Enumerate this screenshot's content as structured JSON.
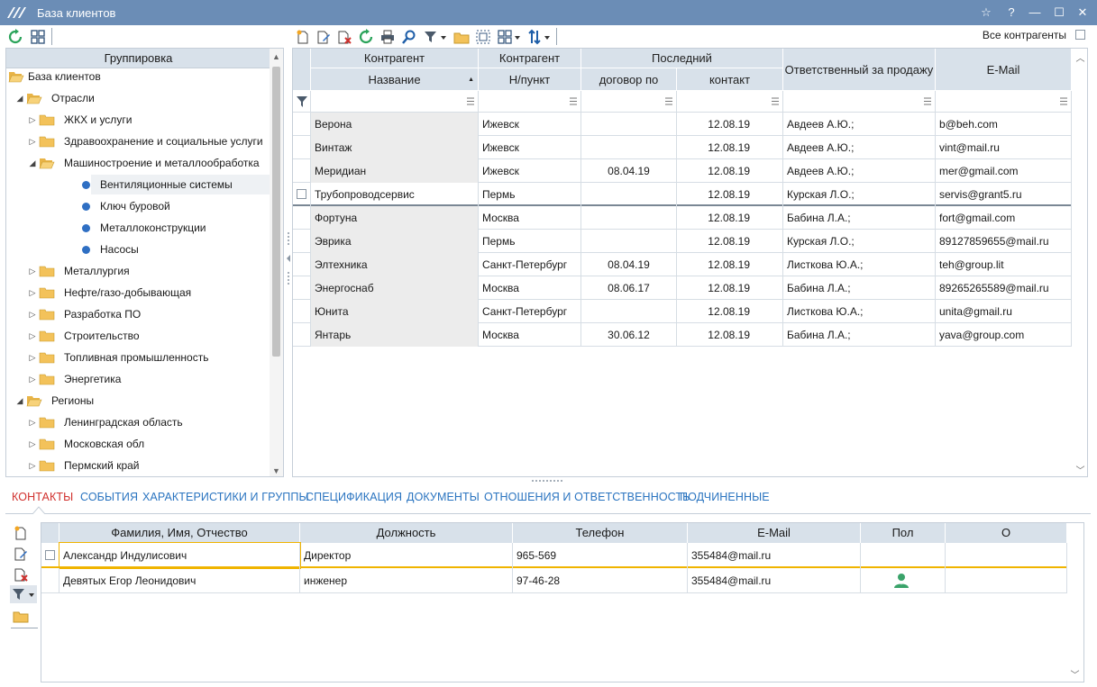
{
  "window": {
    "title": "База клиентов",
    "buttons": [
      "☆",
      "?",
      "—",
      "☐",
      "✕"
    ]
  },
  "toolbar": {
    "all_counterparties_label": "Все контрагенты"
  },
  "tree": {
    "header": "Группировка",
    "items": [
      {
        "label": "База клиентов",
        "kind": "root"
      },
      {
        "label": "Отрасли",
        "kind": "group-open"
      },
      {
        "label": "ЖКХ и услуги",
        "kind": "folder"
      },
      {
        "label": "Здравоохранение и социальные услуги",
        "kind": "folder"
      },
      {
        "label": "Машиностроение и металлообработка",
        "kind": "folder-open"
      },
      {
        "label": "Вентиляционные системы",
        "kind": "leaf",
        "selected": true
      },
      {
        "label": "Ключ буровой",
        "kind": "leaf"
      },
      {
        "label": "Металлоконструкции",
        "kind": "leaf"
      },
      {
        "label": "Насосы",
        "kind": "leaf"
      },
      {
        "label": "Металлургия",
        "kind": "folder"
      },
      {
        "label": "Нефте/газо-добывающая",
        "kind": "folder"
      },
      {
        "label": "Разработка ПО",
        "kind": "folder"
      },
      {
        "label": "Строительство",
        "kind": "folder"
      },
      {
        "label": "Топливная промышленность",
        "kind": "folder"
      },
      {
        "label": "Энергетика",
        "kind": "folder"
      },
      {
        "label": "Регионы",
        "kind": "group-open"
      },
      {
        "label": "Ленинградская область",
        "kind": "folder"
      },
      {
        "label": "Московская обл",
        "kind": "folder"
      },
      {
        "label": "Пермский край",
        "kind": "folder"
      }
    ]
  },
  "grid": {
    "header_top": {
      "kontragent1": "Контрагент",
      "kontragent2": "Контрагент",
      "last": "Последний",
      "responsible": "Ответственный за продажу",
      "email": "E-Mail"
    },
    "header_sub": {
      "name": "Название",
      "city": "Н/пункт",
      "contract": "договор по",
      "contact": "контакт"
    },
    "rows": [
      {
        "name": "Верона",
        "city": "Ижевск",
        "contract": "",
        "contact": "12.08.19",
        "responsible": "Авдеев А.Ю.;",
        "email": "b@beh.com"
      },
      {
        "name": "Винтаж",
        "city": "Ижевск",
        "contract": "",
        "contact": "12.08.19",
        "responsible": "Авдеев А.Ю.;",
        "email": "vint@mail.ru"
      },
      {
        "name": "Меридиан",
        "city": "Ижевск",
        "contract": "08.04.19",
        "contact": "12.08.19",
        "responsible": "Авдеев А.Ю.;",
        "email": "mer@gmail.com"
      },
      {
        "name": "Трубопроводсервис",
        "city": "Пермь",
        "contract": "",
        "contact": "12.08.19",
        "responsible": "Курская Л.О.;",
        "email": "servis@grant5.ru"
      },
      {
        "name": "Фортуна",
        "city": "Москва",
        "contract": "",
        "contact": "12.08.19",
        "responsible": "Бабина Л.А.;",
        "email": "fort@gmail.com"
      },
      {
        "name": "Эврика",
        "city": "Пермь",
        "contract": "",
        "contact": "12.08.19",
        "responsible": "Курская Л.О.;",
        "email": "89127859655@mail.ru"
      },
      {
        "name": "Элтехника",
        "city": "Санкт-Петербург",
        "contract": "08.04.19",
        "contact": "12.08.19",
        "responsible": "Листкова Ю.А.;",
        "email": "teh@group.lit"
      },
      {
        "name": "Энергоснаб",
        "city": "Москва",
        "contract": "08.06.17",
        "contact": "12.08.19",
        "responsible": "Бабина Л.А.;",
        "email": "89265265589@mail.ru"
      },
      {
        "name": "Юнита",
        "city": "Санкт-Петербург",
        "contract": "",
        "contact": "12.08.19",
        "responsible": "Листкова Ю.А.;",
        "email": "unita@gmail.ru"
      },
      {
        "name": "Янтарь",
        "city": "Москва",
        "contract": "30.06.12",
        "contact": "12.08.19",
        "responsible": "Бабина Л.А.;",
        "email": "yava@group.com"
      }
    ]
  },
  "tabs": [
    {
      "label": "КОНТАКТЫ",
      "active": true
    },
    {
      "label": "СОБЫТИЯ"
    },
    {
      "label": "ХАРАКТЕРИСТИКИ И ГРУППЫ"
    },
    {
      "label": "СПЕЦИФИКАЦИЯ"
    },
    {
      "label": "ДОКУМЕНТЫ"
    },
    {
      "label": "ОТНОШЕНИЯ И ОТВЕТСТВЕННОСТЬ"
    },
    {
      "label": "ПОДЧИНЕННЫЕ"
    }
  ],
  "contacts": {
    "headers": {
      "fio": "Фамилия, Имя, Отчество",
      "position": "Должность",
      "phone": "Телефон",
      "email": "E-Mail",
      "gender": "Пол",
      "o": "О"
    },
    "rows": [
      {
        "fio": "Александр Индулисович",
        "position": "Директор",
        "phone": "965-569",
        "email": "355484@mail.ru",
        "gender_icon": ""
      },
      {
        "fio": "Девятых Егор Леонидович",
        "position": "инженер",
        "phone": "97-46-28",
        "email": "355484@mail.ru",
        "gender_icon": "male-user-icon"
      }
    ]
  },
  "colors": {
    "titlebar": "#6b8db6",
    "header_bg": "#d8e1ea",
    "tab_active": "#d1312e",
    "tab_link": "#2a74c0",
    "folder": "#f3c25a",
    "leaf_dot": "#2f6fc3",
    "current_row_line": "#f0b400"
  }
}
